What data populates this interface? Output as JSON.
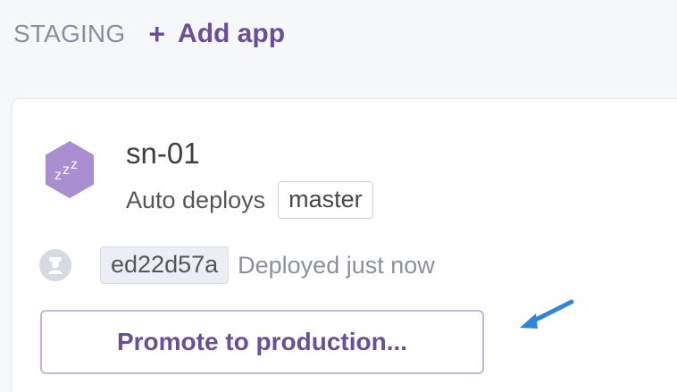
{
  "header": {
    "stage_label": "STAGING",
    "add_app_label": "Add app",
    "add_app_icon": "plus-icon"
  },
  "app": {
    "name": "sn-01",
    "icon": "sleeping-zzz-icon",
    "auto_deploys_label": "Auto deploys",
    "branch": "master",
    "commit": "ed22d57a",
    "deploy_status": "Deployed just now",
    "promote_label": "Promote to production..."
  },
  "colors": {
    "accent": "#6c4f98",
    "hex_fill": "#a98ed0",
    "arrow": "#2f86d6"
  }
}
